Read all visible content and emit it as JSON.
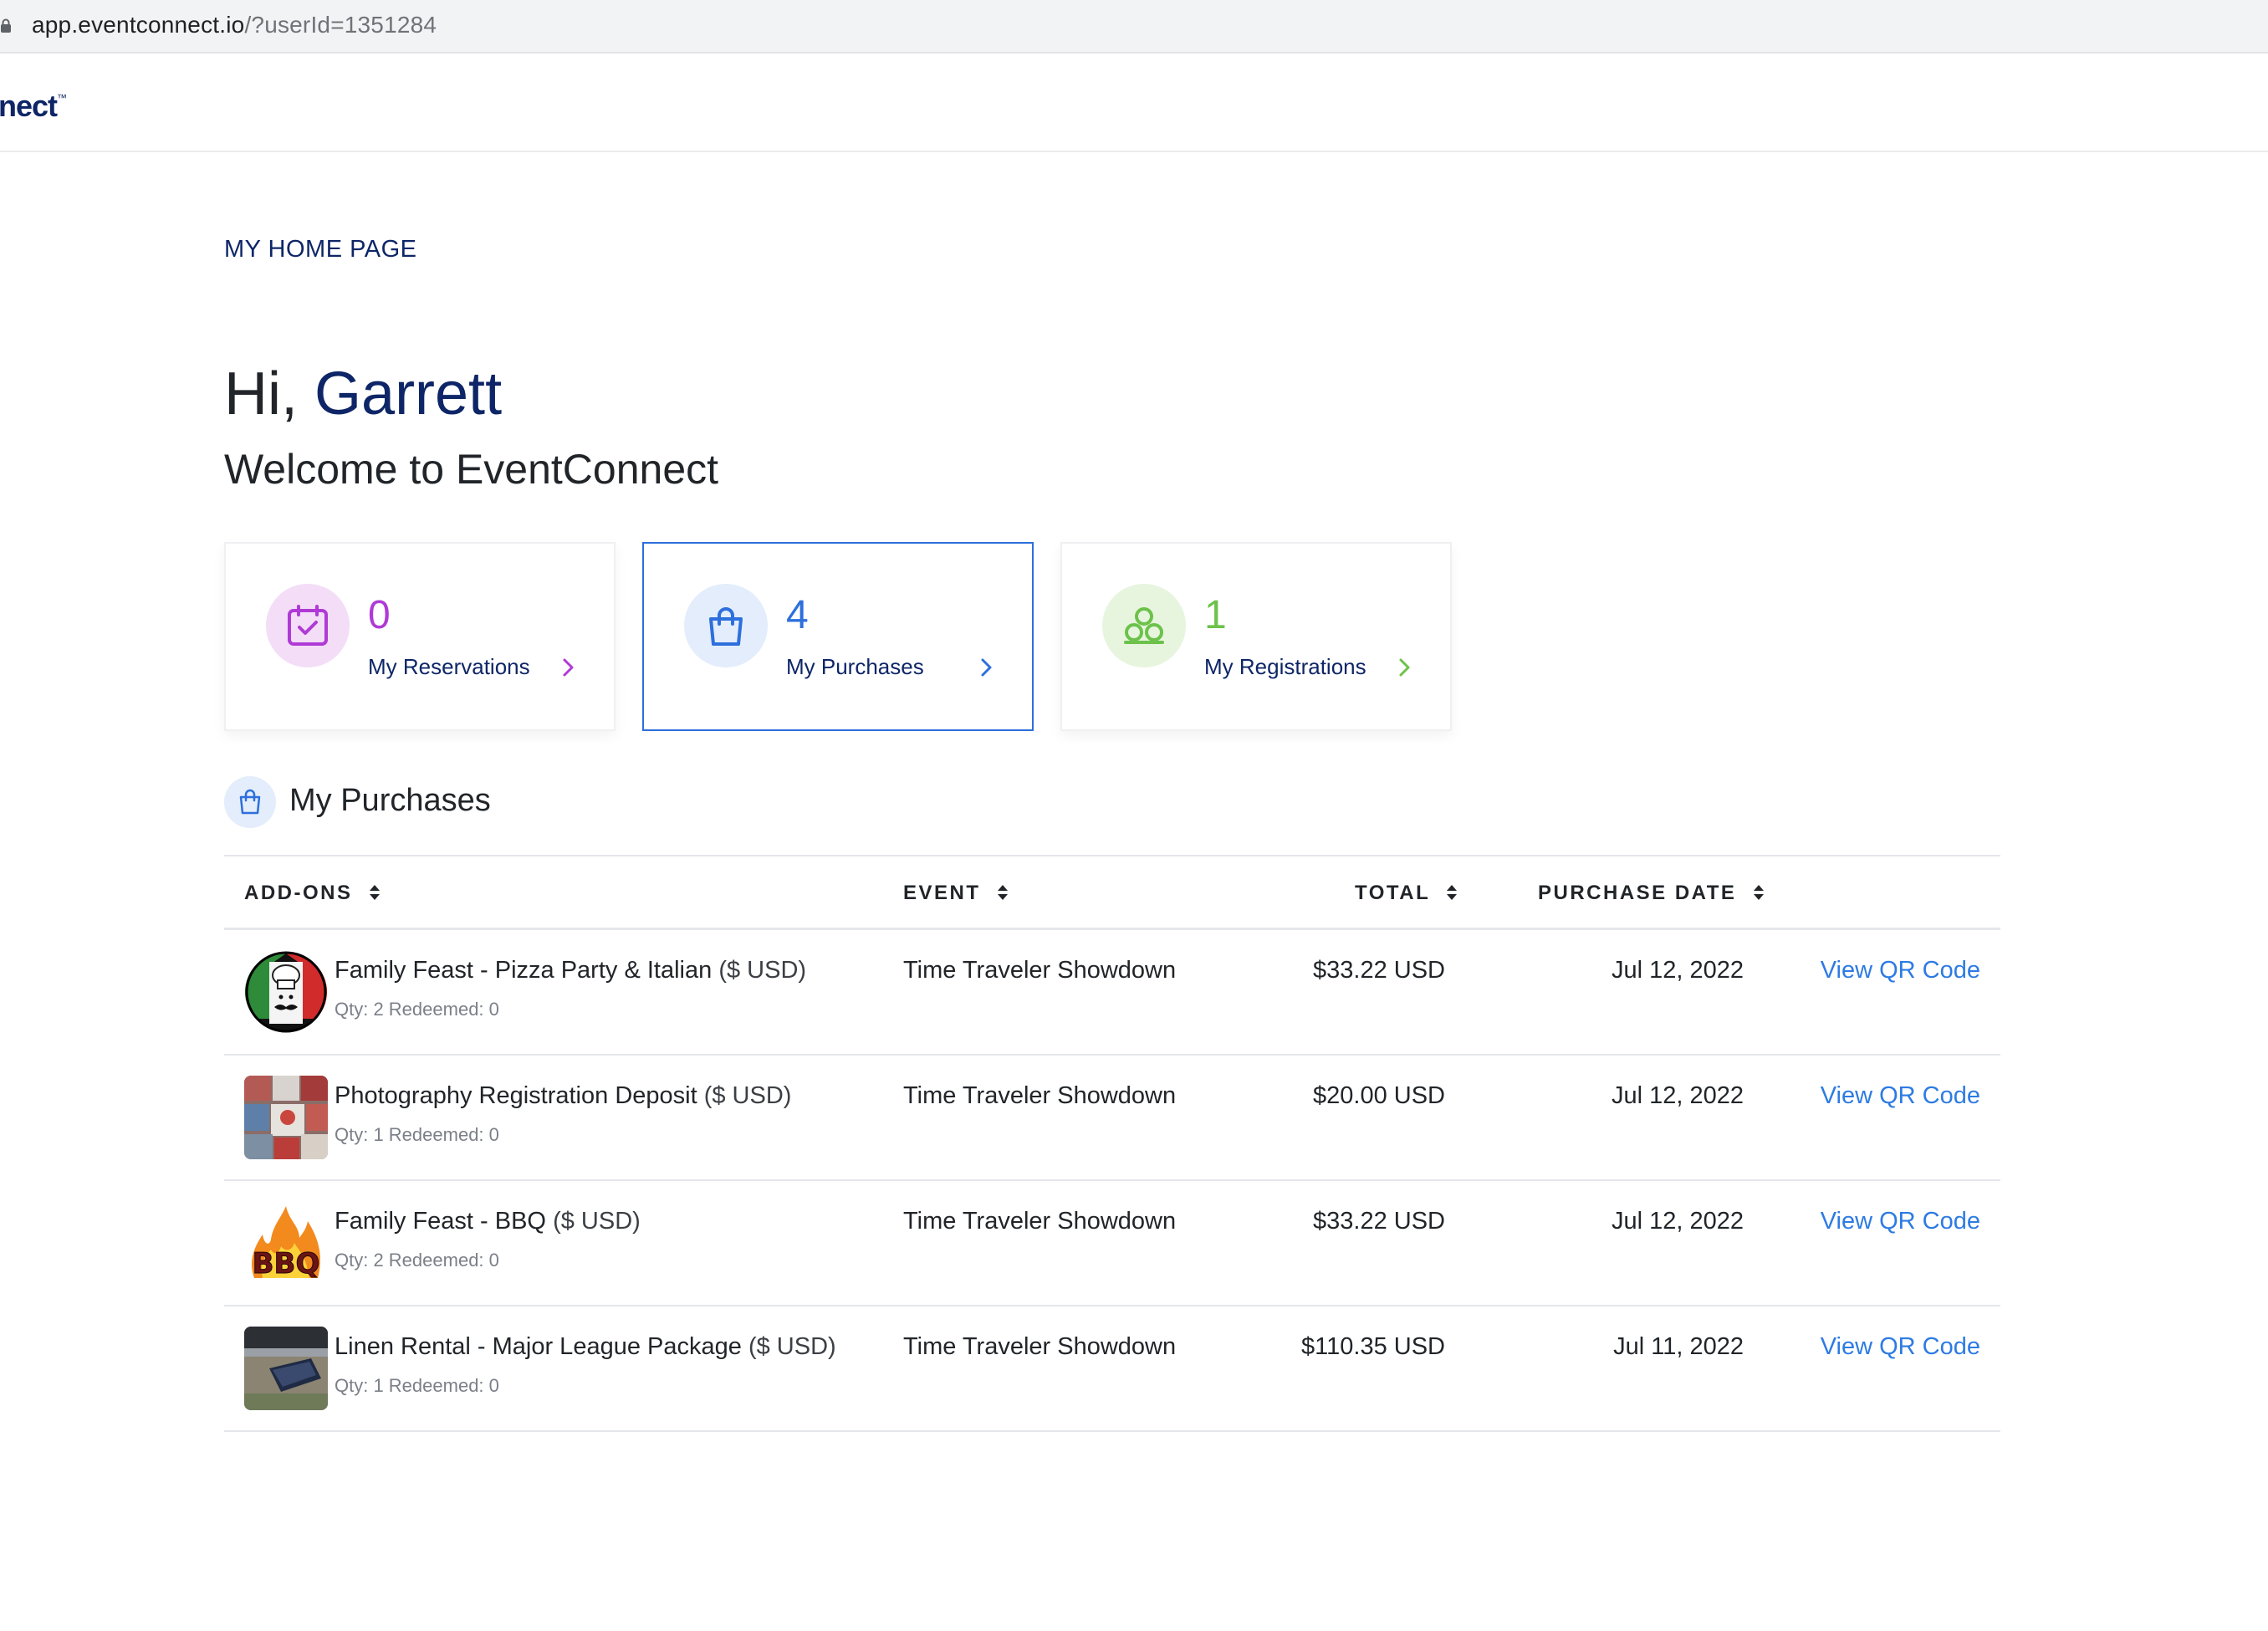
{
  "browser": {
    "url_host": "app.eventconnect.io",
    "url_path": "/?userId=1351284"
  },
  "header": {
    "logo_text": "nect",
    "logo_mark": "™"
  },
  "breadcrumb": "MY HOME PAGE",
  "greeting": {
    "hi": "Hi,",
    "name": "Garrett",
    "welcome": "Welcome to EventConnect"
  },
  "cards": [
    {
      "count": "0",
      "label": "My Reservations",
      "icon": "calendar-check-icon",
      "accent": "#b03ad6",
      "bg": "#f3ddf7"
    },
    {
      "count": "4",
      "label": "My Purchases",
      "icon": "shopping-bag-icon",
      "accent": "#2d6fdc",
      "bg": "#e3edfb"
    },
    {
      "count": "1",
      "label": "My Registrations",
      "icon": "circles-group-icon",
      "accent": "#6cc24a",
      "bg": "#e7f5df"
    }
  ],
  "section": {
    "title": "My Purchases",
    "icon": "shopping-bag-icon"
  },
  "table": {
    "headers": {
      "addons": "ADD-ONS",
      "event": "EVENT",
      "total": "TOTAL",
      "date": "PURCHASE DATE"
    },
    "rows": [
      {
        "name": "Family Feast - Pizza Party & Italian",
        "currency": "($ USD)",
        "meta": "Qty: 2 Redeemed: 0",
        "event": "Time Traveler Showdown",
        "total": "$33.22 USD",
        "date": "Jul 12, 2022",
        "action": "View QR Code",
        "thumb": "italian-chef-thumb"
      },
      {
        "name": "Photography Registration Deposit",
        "currency": "($ USD)",
        "meta": "Qty: 1 Redeemed: 0",
        "event": "Time Traveler Showdown",
        "total": "$20.00 USD",
        "date": "Jul 12, 2022",
        "action": "View QR Code",
        "thumb": "photo-collage-thumb"
      },
      {
        "name": "Family Feast - BBQ",
        "currency": "($ USD)",
        "meta": "Qty: 2 Redeemed: 0",
        "event": "Time Traveler Showdown",
        "total": "$33.22 USD",
        "date": "Jul 12, 2022",
        "action": "View QR Code",
        "thumb": "bbq-flame-thumb",
        "thumb_text": "BBQ"
      },
      {
        "name": "Linen Rental - Major League Package",
        "currency": "($ USD)",
        "meta": "Qty: 1 Redeemed: 0",
        "event": "Time Traveler Showdown",
        "total": "$110.35 USD",
        "date": "Jul 11, 2022",
        "action": "View QR Code",
        "thumb": "dugout-thumb"
      }
    ]
  }
}
